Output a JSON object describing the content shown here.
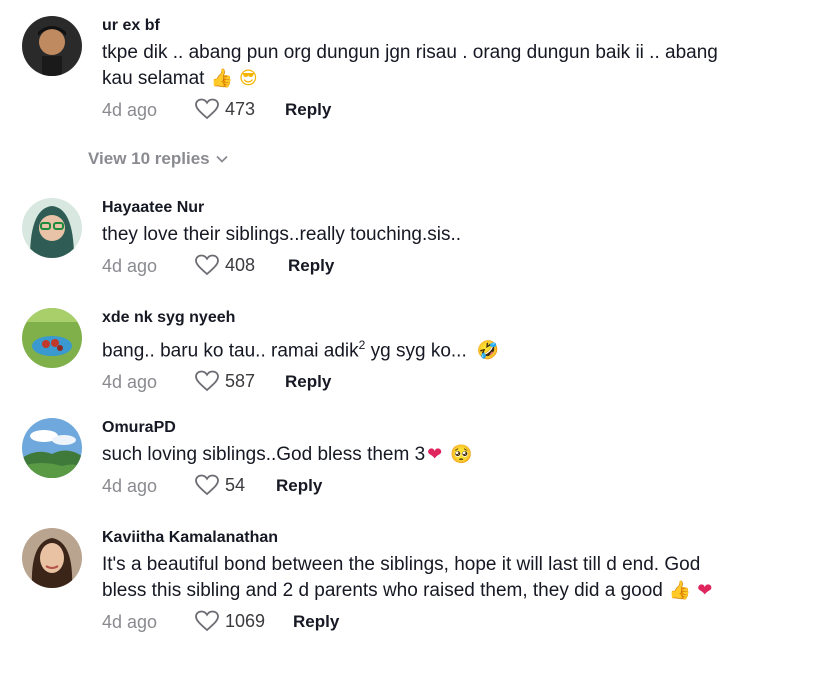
{
  "comments": [
    {
      "username": "ur ex bf",
      "text": "tkpe dik .. abang pun org dungun jgn risau . orang dungun baik ii .. abang kau selamat",
      "emojis": [
        "👍",
        "😎"
      ],
      "time": "4d ago",
      "likes": "473",
      "reply_label": "Reply"
    },
    {
      "username": "Hayaatee Nur",
      "text": "they love their siblings..really touching.sis..",
      "time": "4d ago",
      "likes": "408",
      "reply_label": "Reply"
    },
    {
      "username": "xde nk syg nyeeh",
      "text_before_sup": "bang.. baru ko tau.. ramai adik",
      "sup": "2",
      "text_after_sup": " yg syg ko...",
      "emojis": [
        "🤣"
      ],
      "time": "4d ago",
      "likes": "587",
      "reply_label": "Reply"
    },
    {
      "username": "OmuraPD",
      "text": "such loving siblings..God bless them 3",
      "emojis": [
        "❤",
        "🥺"
      ],
      "time": "4d ago",
      "likes": "54",
      "reply_label": "Reply"
    },
    {
      "username": "Kaviitha Kamalanathan",
      "text": "It's a beautiful bond between the siblings, hope it will last till d end. God bless this sibling and 2 d parents who raised them, they did a good",
      "emojis": [
        "👍",
        "❤"
      ],
      "time": "4d ago",
      "likes": "1069",
      "reply_label": "Reply"
    }
  ],
  "view_replies": "View 10 replies",
  "colors": {
    "text": "#161823",
    "muted": "#8a8b91",
    "heart_outline": "#6b6c72"
  },
  "icons": {
    "heart": "heart-outline-icon",
    "chevron": "chevron-down-icon"
  }
}
